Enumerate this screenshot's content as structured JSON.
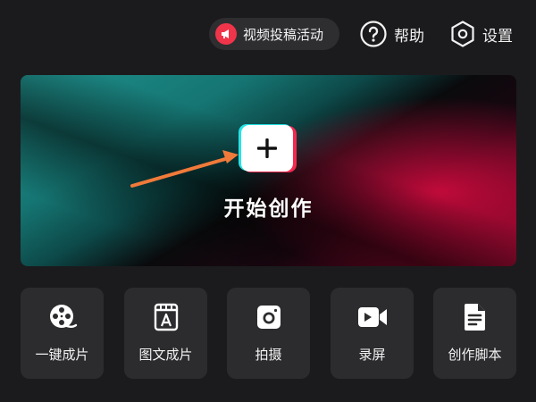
{
  "header": {
    "promo_label": "视频投稿活动",
    "help_label": "帮助",
    "settings_label": "设置"
  },
  "hero": {
    "label": "开始创作"
  },
  "tools": [
    {
      "label": "一键成片",
      "icon": "film-reel-icon"
    },
    {
      "label": "图文成片",
      "icon": "text-document-icon"
    },
    {
      "label": "拍摄",
      "icon": "camera-icon"
    },
    {
      "label": "录屏",
      "icon": "video-camera-icon"
    },
    {
      "label": "创作脚本",
      "icon": "script-document-icon"
    }
  ],
  "colors": {
    "background": "#1b1b1d",
    "tile": "#2c2c2f",
    "promo_accent": "#f0344a",
    "cyan": "#25e4e6",
    "red": "#f4294f",
    "arrow": "#f07a3a"
  }
}
